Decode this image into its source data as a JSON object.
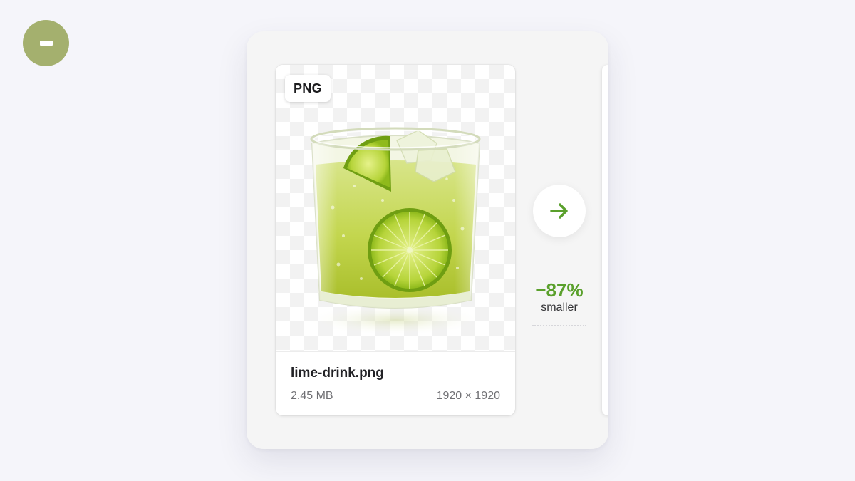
{
  "window": {
    "collapse_button_icon": "minus-icon",
    "collapse_button_color": "#a4b06e"
  },
  "file_card": {
    "format_badge": "PNG",
    "file_name": "lime-drink.png",
    "file_size": "2.45 MB",
    "dimensions": "1920 × 1920",
    "preview_subject": "glass of lime soda with ice and lime slices"
  },
  "compression": {
    "arrow_icon": "arrow-right-icon",
    "percent": "−87%",
    "label": "smaller",
    "accent_color": "#5aa02c"
  }
}
